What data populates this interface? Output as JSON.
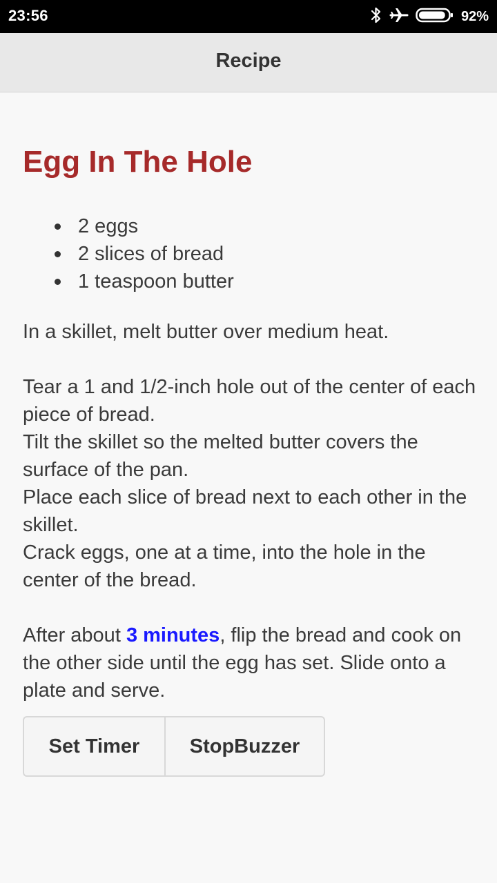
{
  "status_bar": {
    "time": "23:56",
    "battery_percent": "92%",
    "battery_level": 0.92,
    "icons": [
      "bluetooth-icon",
      "airplane-icon",
      "battery-icon"
    ]
  },
  "app_bar": {
    "title": "Recipe"
  },
  "recipe": {
    "title": "Egg In The Hole",
    "title_color": "#a62a2a",
    "ingredients": [
      "2 eggs",
      "2 slices of bread",
      "1 teaspoon butter"
    ],
    "step_intro": "In a skillet, melt butter over medium heat.",
    "steps": [
      "Tear a 1 and 1/2-inch hole out of the center of each piece of bread.",
      "Tilt the skillet so the melted butter covers the surface of the pan.",
      "Place each slice of bread next to each other in the skillet.",
      "Crack eggs, one at a time, into the hole in the center of the bread."
    ],
    "final_before": "After about ",
    "final_time_link": "3 minutes",
    "final_after": ", flip the bread and cook on the other side until the egg has set. Slide onto a plate and serve.",
    "link_color": "#1a1aff"
  },
  "buttons": {
    "set_timer": "Set Timer",
    "stop_buzzer": "StopBuzzer"
  }
}
